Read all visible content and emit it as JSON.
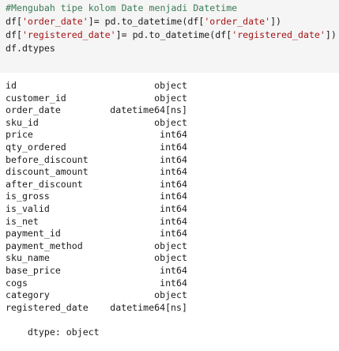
{
  "code": {
    "comment": "#Mengubah tipe kolom Date menjadi Datetime",
    "line1_pre": "df[",
    "line1_key": "'order_date'",
    "line1_mid": "]= pd.to_datetime(df[",
    "line1_key2": "'order_date'",
    "line1_post": "])",
    "line2_pre": "df[",
    "line2_key": "'registered_date'",
    "line2_mid": "]= pd.to_datetime(df[",
    "line2_key2": "'registered_date'",
    "line2_post": "])",
    "line3": "df.dtypes"
  },
  "output": {
    "rows": [
      {
        "name": "id",
        "type": "object"
      },
      {
        "name": "customer_id",
        "type": "object"
      },
      {
        "name": "order_date",
        "type": "datetime64[ns]"
      },
      {
        "name": "sku_id",
        "type": "object"
      },
      {
        "name": "price",
        "type": "int64"
      },
      {
        "name": "qty_ordered",
        "type": "int64"
      },
      {
        "name": "before_discount",
        "type": "int64"
      },
      {
        "name": "discount_amount",
        "type": "int64"
      },
      {
        "name": "after_discount",
        "type": "int64"
      },
      {
        "name": "is_gross",
        "type": "int64"
      },
      {
        "name": "is_valid",
        "type": "int64"
      },
      {
        "name": "is_net",
        "type": "int64"
      },
      {
        "name": "payment_id",
        "type": "int64"
      },
      {
        "name": "payment_method",
        "type": "object"
      },
      {
        "name": "sku_name",
        "type": "object"
      },
      {
        "name": "base_price",
        "type": "int64"
      },
      {
        "name": "cogs",
        "type": "int64"
      },
      {
        "name": "category",
        "type": "object"
      },
      {
        "name": "registered_date",
        "type": "datetime64[ns]"
      }
    ],
    "footer": "dtype: object"
  },
  "colors": {
    "cell_bg": "#f5f5f5",
    "comment": "#3b7a57",
    "string": "#a31515",
    "text": "#1b1b1b"
  }
}
